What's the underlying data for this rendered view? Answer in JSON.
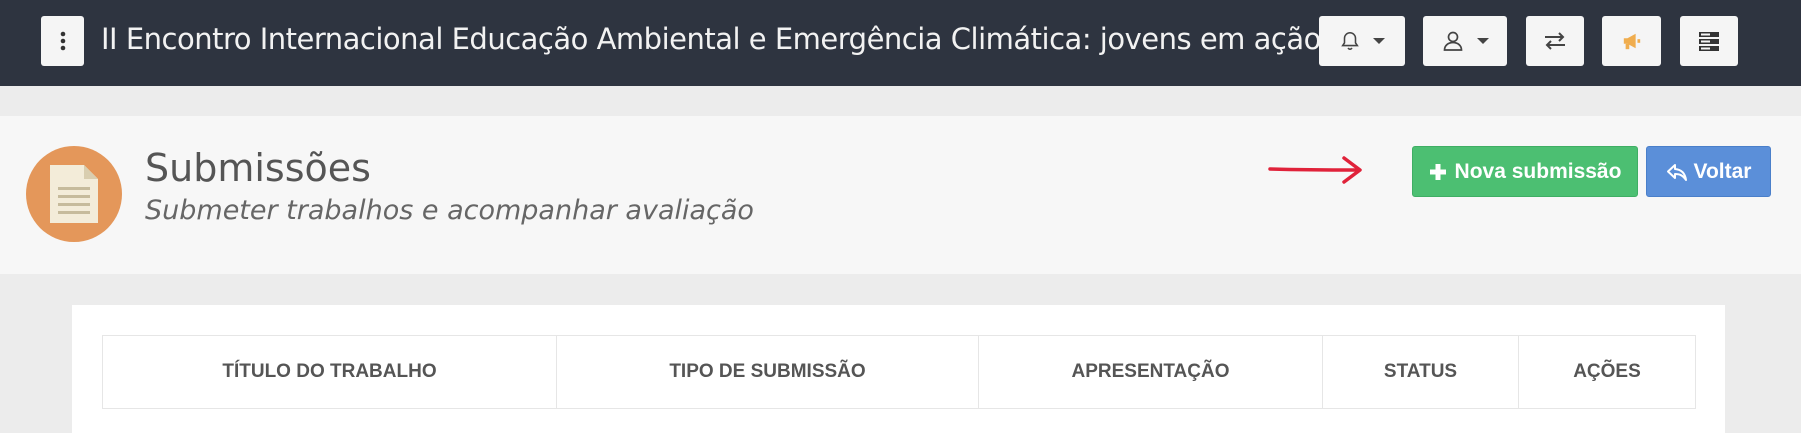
{
  "topbar": {
    "title": "II Encontro Internacional Educação Ambiental e Emergência Climática: jovens em ação",
    "buttons": [
      {
        "icon": "bell-icon",
        "has_caret": true
      },
      {
        "icon": "user-icon",
        "has_caret": true
      },
      {
        "icon": "swap-icon",
        "has_caret": false
      },
      {
        "icon": "megaphone-icon",
        "has_caret": false,
        "color": "#f0ad4e"
      },
      {
        "icon": "server-icon",
        "has_caret": false
      }
    ]
  },
  "page_header": {
    "icon": "document-icon",
    "icon_bg": "#e4975a",
    "title": "Submissões",
    "subtitle": "Submeter trabalhos e acompanhar avaliação"
  },
  "actions": {
    "new_label": "Nova submissão",
    "new_icon": "plus-icon",
    "new_color": "#4cbf72",
    "back_label": "Voltar",
    "back_icon": "reply-icon",
    "back_color": "#5b8fd9",
    "annotation_arrow_color": "#e0223a"
  },
  "table": {
    "headers": [
      "TÍTULO DO TRABALHO",
      "TIPO DE SUBMISSÃO",
      "APRESENTAÇÃO",
      "STATUS",
      "AÇÕES"
    ]
  }
}
